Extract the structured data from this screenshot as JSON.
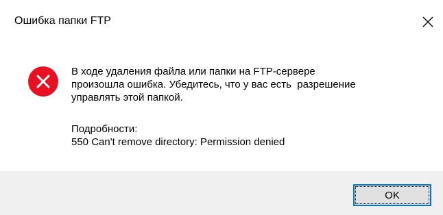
{
  "window": {
    "title": "Ошибка папки FTP"
  },
  "icons": {
    "close": "close-icon",
    "error": "error-icon"
  },
  "colors": {
    "error_red": "#e81123",
    "accent": "#0078d7",
    "footer_bg": "#f0f0f0"
  },
  "message": {
    "line1": "В ходе удаления файла или папки на FTP-сервере",
    "line2": "произошла ошибка. Убедитесь, что у вас есть  разрешение",
    "line3": "управлять этой папкой."
  },
  "details": {
    "label": "Подробности:",
    "text": "550 Can't remove directory: Permission denied"
  },
  "buttons": {
    "ok_label": "OK"
  }
}
